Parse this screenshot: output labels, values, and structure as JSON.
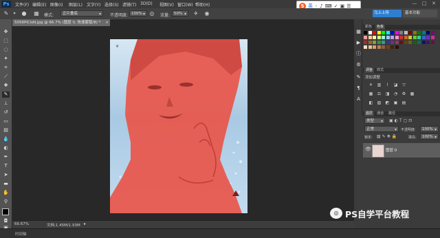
{
  "app": {
    "logo": "Ps"
  },
  "menu": [
    "文件(F)",
    "编辑(E)",
    "图像(I)",
    "图层(L)",
    "文字(Y)",
    "选择(S)",
    "滤镜(T)",
    "3D(D)",
    "视图(V)",
    "窗口(W)",
    "帮助(H)"
  ],
  "window_controls": [
    "—",
    "□",
    "✕"
  ],
  "options_bar": {
    "mode_label": "模式:",
    "mode_value": "正片叠底",
    "opacity_label": "不透明度:",
    "opacity_value": "100%",
    "flow_label": "流量:",
    "flow_value": "50%"
  },
  "sogou": {
    "label": "英",
    "icons": [
      "◦",
      "♪",
      "⌨",
      "✓",
      "▣",
      "☰"
    ]
  },
  "header_buttons": {
    "upload": "马上上传",
    "workspace": "基本功能"
  },
  "document": {
    "tab_title": "5056PiCisN.jpg @ 66.7% (图层 0, 快速蒙版/8) *",
    "close": "×"
  },
  "status": {
    "zoom": "66.67%",
    "doc_info": "文档:1.45M/1.93M",
    "timeline": "时间轴"
  },
  "panels": {
    "color_tabs": [
      "颜色",
      "色板"
    ],
    "adjust_tabs": [
      "调整",
      "样式"
    ],
    "adjust_caption": "添加调整",
    "layers_tabs": [
      "图层",
      "通道",
      "路径"
    ],
    "kind_filter": "类型",
    "blend_mode": "正常",
    "opacity_label": "不透明度:",
    "opacity_value": "100%",
    "lock_label": "锁定:",
    "fill_label": "填充:",
    "fill_value": "100%",
    "layer_name": "图层 0"
  },
  "watermark": {
    "text": "PS自学平台教程"
  },
  "colors": {
    "mask": "#e8564b",
    "swatches": [
      "#000000",
      "#ffffff",
      "#ff0000",
      "#ffff00",
      "#00ff00",
      "#00ffff",
      "#0000ff",
      "#ff00ff",
      "#808080",
      "#c0c0c0",
      "#800000",
      "#808000",
      "#008000",
      "#008080",
      "#000080",
      "#800080",
      "#ff9999",
      "#ffcc99",
      "#ffff99",
      "#ccff99",
      "#99ffcc",
      "#99ccff",
      "#cc99ff",
      "#ff99cc",
      "#cc3333",
      "#cc6633",
      "#cccc33",
      "#66cc33",
      "#33cc99",
      "#3366cc",
      "#6633cc",
      "#cc3399",
      "#993333",
      "#996633",
      "#999933",
      "#339933",
      "#339999",
      "#333399",
      "#663399",
      "#993366",
      "#661111",
      "#664411",
      "#666611",
      "#116611",
      "#116666",
      "#111166",
      "#441166",
      "#661144",
      "#ffe0c0",
      "#f0c090",
      "#d8a070",
      "#b88050",
      "#906040",
      "#704020",
      "#502000",
      "#301000"
    ]
  }
}
